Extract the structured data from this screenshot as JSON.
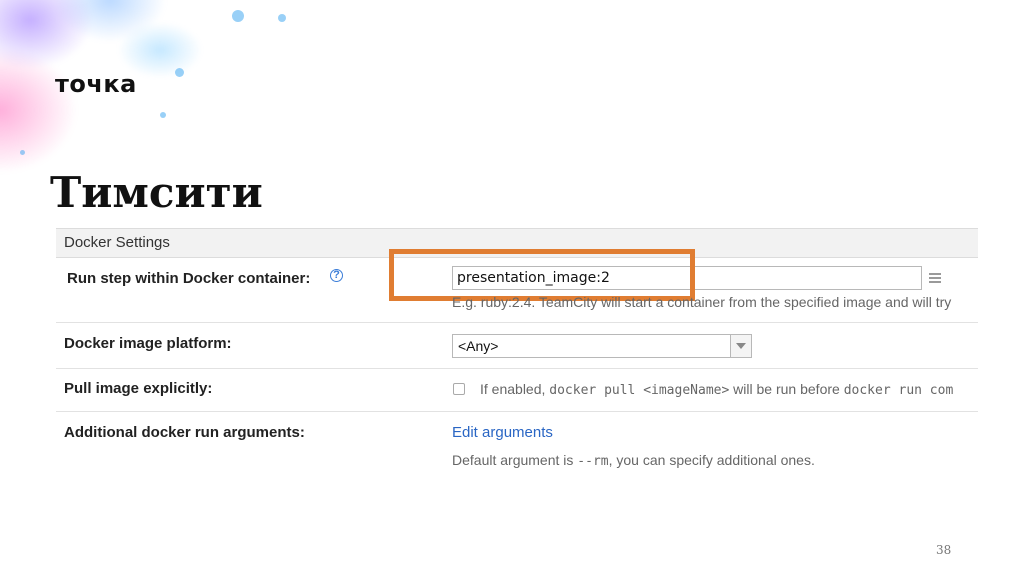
{
  "brand": {
    "logo_text": "точка"
  },
  "slide": {
    "title": "Тимсити",
    "page_number": "38"
  },
  "colors": {
    "highlight": "#e07d32",
    "link": "#2a66c4"
  },
  "panel": {
    "header": "Docker Settings",
    "rows": {
      "run_step": {
        "label": "Run step within Docker container:",
        "help_icon": "question-icon",
        "input_value": "presentation_image:2",
        "hint": "E.g. ruby:2.4. TeamCity will start a container from the specified image and will try"
      },
      "platform": {
        "label": "Docker image platform:",
        "selected": "<Any>"
      },
      "pull": {
        "label": "Pull image explicitly:",
        "hint_prefix": "If enabled, ",
        "hint_code1": "docker pull <imageName>",
        "hint_middle": " will be run before ",
        "hint_code2": "docker run com"
      },
      "args": {
        "label": "Additional docker run arguments:",
        "link": "Edit arguments",
        "hint_prefix": "Default argument is ",
        "hint_code": "--rm",
        "hint_suffix": ", you can specify additional ones."
      }
    }
  }
}
